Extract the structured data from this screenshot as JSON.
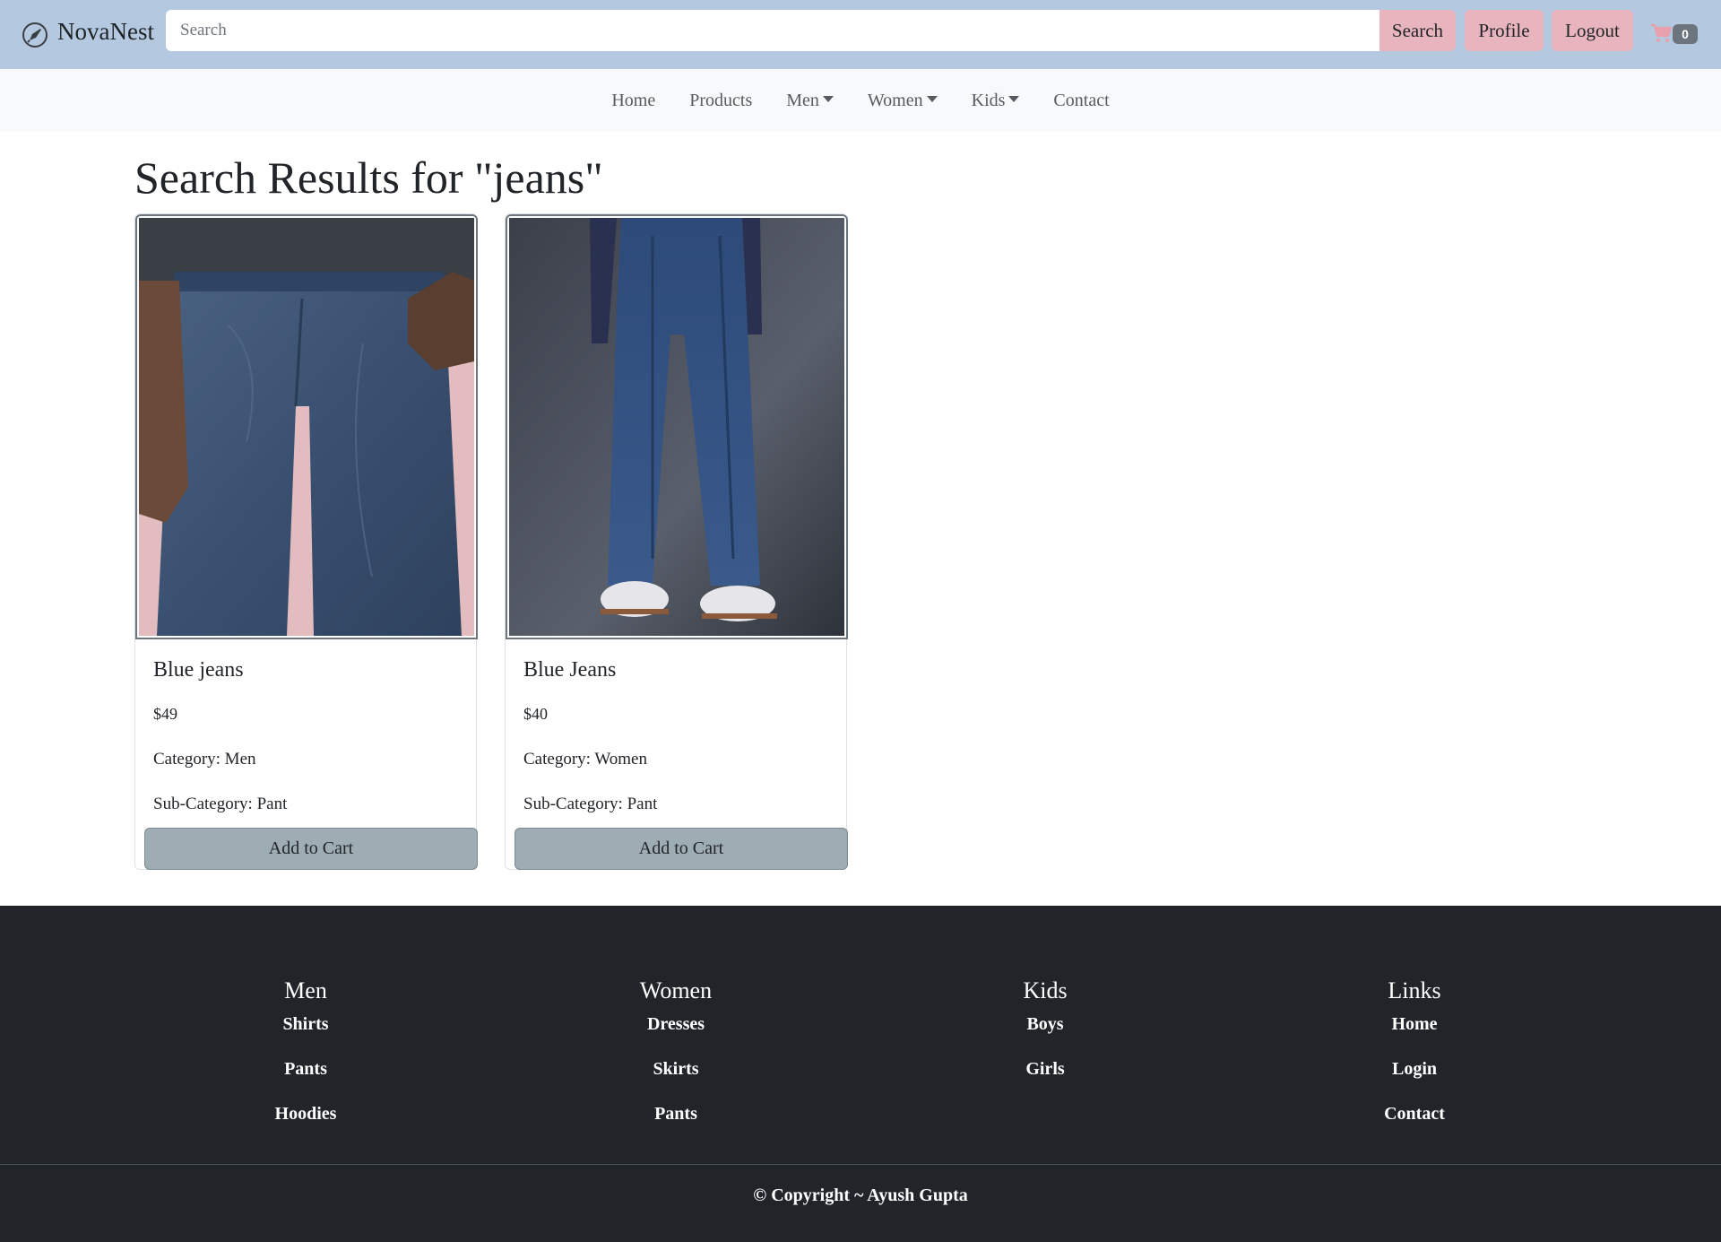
{
  "header": {
    "brand": "NovaNest",
    "logo_icon": "rocket-icon",
    "search_placeholder": "Search",
    "search_button": "Search",
    "profile_button": "Profile",
    "logout_button": "Logout",
    "cart_icon": "cart-icon",
    "cart_count": "0",
    "colors": {
      "topbar": "#b4c8e0",
      "button": "#e8b4bd"
    }
  },
  "nav": {
    "items": [
      {
        "label": "Home",
        "dropdown": false
      },
      {
        "label": "Products",
        "dropdown": false
      },
      {
        "label": "Men",
        "dropdown": true
      },
      {
        "label": "Women",
        "dropdown": true
      },
      {
        "label": "Kids",
        "dropdown": true
      },
      {
        "label": "Contact",
        "dropdown": false
      }
    ]
  },
  "main": {
    "title": "Search Results for \"jeans\"",
    "products": [
      {
        "name": "Blue jeans",
        "price": "$49",
        "category": "Category: Men",
        "subcategory": "Sub-Category: Pant",
        "button": "Add to Cart",
        "image": "men-jeans-photo"
      },
      {
        "name": "Blue Jeans",
        "price": "$40",
        "category": "Category: Women",
        "subcategory": "Sub-Category: Pant",
        "button": "Add to Cart",
        "image": "women-jeans-photo"
      }
    ]
  },
  "footer": {
    "columns": [
      {
        "heading": "Men",
        "links": [
          "Shirts",
          "Pants",
          "Hoodies"
        ]
      },
      {
        "heading": "Women",
        "links": [
          "Dresses",
          "Skirts",
          "Pants"
        ]
      },
      {
        "heading": "Kids",
        "links": [
          "Boys",
          "Girls"
        ]
      },
      {
        "heading": "Links",
        "links": [
          "Home",
          "Login",
          "Contact"
        ]
      }
    ],
    "copyright": "© Copyright ~ Ayush Gupta",
    "background": "#212529"
  }
}
